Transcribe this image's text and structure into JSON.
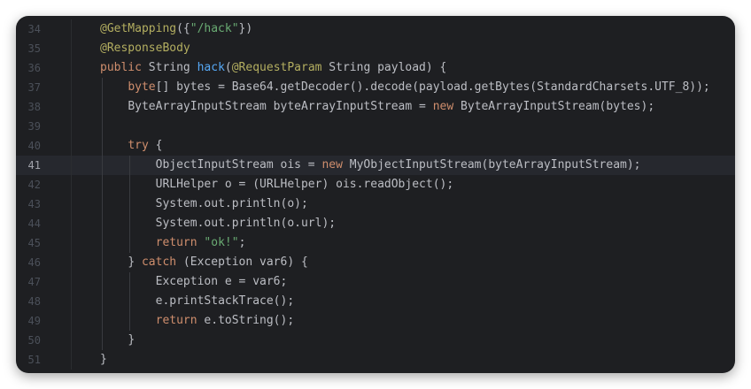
{
  "editor": {
    "lines": [
      {
        "n": "34",
        "indent": 1,
        "tokens": [
          {
            "t": "@GetMapping",
            "c": "ann"
          },
          {
            "t": "({",
            "c": "plain"
          },
          {
            "t": "\"/hack\"",
            "c": "str"
          },
          {
            "t": "})",
            "c": "plain"
          }
        ]
      },
      {
        "n": "35",
        "indent": 1,
        "tokens": [
          {
            "t": "@ResponseBody",
            "c": "ann"
          }
        ]
      },
      {
        "n": "36",
        "indent": 1,
        "tokens": [
          {
            "t": "public",
            "c": "kw"
          },
          {
            "t": " String ",
            "c": "plain"
          },
          {
            "t": "hack",
            "c": "fn"
          },
          {
            "t": "(",
            "c": "plain"
          },
          {
            "t": "@RequestParam",
            "c": "ann"
          },
          {
            "t": " String payload) {",
            "c": "plain"
          }
        ]
      },
      {
        "n": "37",
        "indent": 2,
        "tokens": [
          {
            "t": "byte",
            "c": "kw"
          },
          {
            "t": "[] bytes = Base64.getDecoder().decode(payload.getBytes(StandardCharsets.UTF_8));",
            "c": "plain"
          }
        ]
      },
      {
        "n": "38",
        "indent": 2,
        "tokens": [
          {
            "t": "ByteArrayInputStream byteArrayInputStream = ",
            "c": "plain"
          },
          {
            "t": "new",
            "c": "kw"
          },
          {
            "t": " ByteArrayInputStream(bytes);",
            "c": "plain"
          }
        ]
      },
      {
        "n": "39",
        "indent": 2,
        "tokens": []
      },
      {
        "n": "40",
        "indent": 2,
        "tokens": [
          {
            "t": "try",
            "c": "kw"
          },
          {
            "t": " {",
            "c": "plain"
          }
        ]
      },
      {
        "n": "41",
        "indent": 3,
        "current": true,
        "tokens": [
          {
            "t": "ObjectInputStream ois = ",
            "c": "plain"
          },
          {
            "t": "new",
            "c": "kw"
          },
          {
            "t": " MyObjectInputStream(byteArrayInputStream);",
            "c": "plain"
          }
        ]
      },
      {
        "n": "42",
        "indent": 3,
        "tokens": [
          {
            "t": "URLHelper o = (URLHelper) ois.readObject();",
            "c": "plain"
          }
        ]
      },
      {
        "n": "43",
        "indent": 3,
        "tokens": [
          {
            "t": "System.out.println(o);",
            "c": "plain"
          }
        ]
      },
      {
        "n": "44",
        "indent": 3,
        "tokens": [
          {
            "t": "System.out.println(o.url);",
            "c": "plain"
          }
        ]
      },
      {
        "n": "45",
        "indent": 3,
        "tokens": [
          {
            "t": "return",
            "c": "kw"
          },
          {
            "t": " ",
            "c": "plain"
          },
          {
            "t": "\"ok!\"",
            "c": "str"
          },
          {
            "t": ";",
            "c": "plain"
          }
        ]
      },
      {
        "n": "46",
        "indent": 2,
        "tokens": [
          {
            "t": "} ",
            "c": "plain"
          },
          {
            "t": "catch",
            "c": "kw"
          },
          {
            "t": " (Exception var6) {",
            "c": "plain"
          }
        ]
      },
      {
        "n": "47",
        "indent": 3,
        "tokens": [
          {
            "t": "Exception e = var6;",
            "c": "plain"
          }
        ]
      },
      {
        "n": "48",
        "indent": 3,
        "tokens": [
          {
            "t": "e.printStackTrace();",
            "c": "plain"
          }
        ]
      },
      {
        "n": "49",
        "indent": 3,
        "tokens": [
          {
            "t": "return",
            "c": "kw"
          },
          {
            "t": " e.toString();",
            "c": "plain"
          }
        ]
      },
      {
        "n": "50",
        "indent": 2,
        "tokens": [
          {
            "t": "}",
            "c": "plain"
          }
        ]
      },
      {
        "n": "51",
        "indent": 1,
        "tokens": [
          {
            "t": "}",
            "c": "plain"
          }
        ]
      }
    ]
  }
}
